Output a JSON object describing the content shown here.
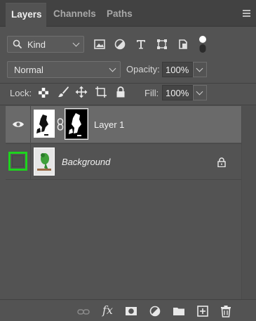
{
  "tabs": [
    {
      "label": "Layers",
      "active": true
    },
    {
      "label": "Channels",
      "active": false
    },
    {
      "label": "Paths",
      "active": false
    }
  ],
  "filter": {
    "kind_label": "Kind",
    "icons": [
      "image-filter-icon",
      "adjustment-filter-icon",
      "type-filter-icon",
      "shape-filter-icon",
      "smart-object-filter-icon",
      "filter-toggle-icon"
    ]
  },
  "blend": {
    "mode": "Normal",
    "opacity_label": "Opacity:",
    "opacity_value": "100%"
  },
  "lock": {
    "label": "Lock:",
    "icons": [
      "lock-transparent-pixels-icon",
      "lock-image-pixels-icon",
      "lock-position-icon",
      "lock-artboard-icon",
      "lock-all-icon"
    ],
    "fill_label": "Fill:",
    "fill_value": "100%"
  },
  "layers": [
    {
      "name": "Layer 1",
      "visible": true,
      "selected": true,
      "has_mask": true,
      "locked": false
    },
    {
      "name": "Background",
      "visible": false,
      "selected": false,
      "has_mask": false,
      "locked": true
    }
  ],
  "bottom_icons": [
    "link-layers-icon",
    "fx-icon",
    "add-mask-icon",
    "adjustment-layer-icon",
    "new-group-icon",
    "new-layer-icon",
    "delete-layer-icon"
  ],
  "bottom_fx_text": "fx",
  "colors": {
    "panel_bg": "#535353",
    "selected_row": "#6a6a6a",
    "highlight_box": "#1ed41e"
  }
}
